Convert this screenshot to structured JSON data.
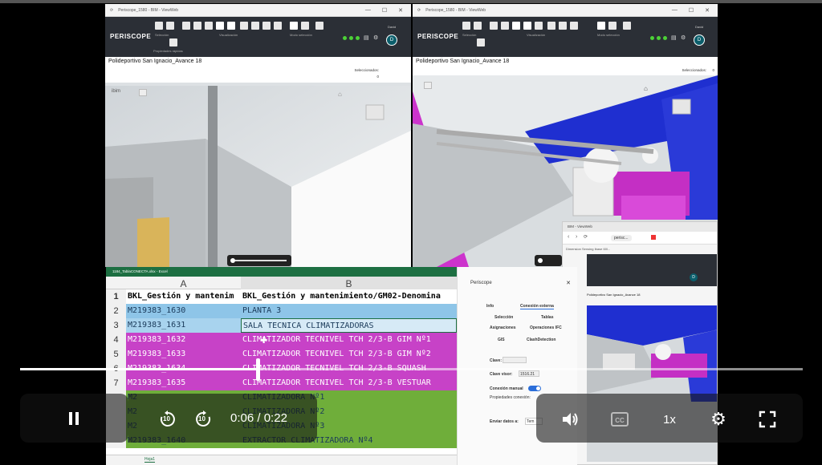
{
  "left_window": {
    "tab_title": "Periscope_1580 - BIM - ViewWeb",
    "brand": "PERISCOPE",
    "ribbon_groups": [
      "Selección",
      "Visualización",
      "Modo selección",
      "Propiedades rápidas"
    ],
    "user": "David",
    "avatar_letter": "D",
    "doc_title": "Polideportivo San Ignacio_Avance 18",
    "selected_label": "Seleccionados:",
    "selected_count": "0",
    "viewer_tag": "ibim"
  },
  "right_window": {
    "tab_title": "Periscope_1580 - BIM - ViewWeb",
    "brand": "PERISCOPE",
    "ribbon_groups": [
      "Selección",
      "Visualización",
      "Modo selección"
    ],
    "user": "David",
    "avatar_letter": "D",
    "doc_title": "Polideportivo San Ignacio_Avance 18",
    "selected_label": "Seleccionados:",
    "selected_count": "0"
  },
  "mini_window": {
    "tab_title": "BIM - ViewWeb",
    "address": "perisc...",
    "breadcrumb": "Dimension Sensing Ibase 60l...",
    "doc_title": "Polideportivo San Ignacio_Avance 18",
    "avatar_letter": "D"
  },
  "excel": {
    "title": "1184_TablaCONECTA.xlsx - Excel",
    "col_a": "A",
    "col_b": "B",
    "header_a": "BKL_Gestión y mantenim",
    "header_b": "BKL_Gestión y mantenimiento/GM02-Denomina",
    "rows": [
      {
        "n": "2",
        "a": "M219383_1630",
        "b": "PLANTA 3"
      },
      {
        "n": "3",
        "a": "M219383_1631",
        "b": "SALA TECNICA CLIMATIZADORAS"
      },
      {
        "n": "4",
        "a": "M219383_1632",
        "b": "CLIMATIZADOR TECNIVEL TCH 2/3-B GIM Nº1"
      },
      {
        "n": "5",
        "a": "M219383_1633",
        "b": "CLIMATIZADOR TECNIVEL TCH 2/3-B GIM Nº2"
      },
      {
        "n": "6",
        "a": "M219383_1634",
        "b": "CLIMATIZADOR TECNIVEL TCH 2/3-B SQUASH"
      },
      {
        "n": "7",
        "a": "M219383_1635",
        "b": "CLIMATIZADOR TECNIVEL TCH 2/3-B VESTUAR"
      },
      {
        "n": "",
        "a": "M2",
        "b": "CLIMATIZADORA Nº1"
      },
      {
        "n": "",
        "a": "M2",
        "b": "CLIMATIZADORA Nº2"
      },
      {
        "n": "",
        "a": "M2",
        "b": "CLIMATIZADORA Nº3"
      },
      {
        "n": "",
        "a": "M219383_1640",
        "b": "EXTRACTOR CLIMATIZADORA Nº4"
      }
    ],
    "sheet_tab": "Hoja1"
  },
  "periscope_panel": {
    "title": "Periscope",
    "tab_info": "Info",
    "tab_conexion": "Conexión externa",
    "btn_seleccion": "Selección",
    "btn_tablas": "Tablas",
    "btn_asignaciones": "Asignaciones",
    "btn_operaciones": "Operaciones IFC",
    "btn_gis": "GIS",
    "btn_clash": "ClashDetection",
    "clave_label": "Clave:",
    "clave_visor_label": "Clave visor:",
    "clave_visor_value": "1516.21",
    "conexion_manual": "Conexión manual",
    "propiedades_label": "Propiedades conexión:",
    "enviar_label": "Enviar datos a:",
    "enviar_value": "Tem"
  },
  "player": {
    "current_time": "0:06",
    "separator": "/",
    "duration": "0:22",
    "progress": 0.304,
    "speed": "1x",
    "rewind_seconds": "10",
    "forward_seconds": "10"
  },
  "colors": {
    "magenta": "#c030c0",
    "blue_row": "#8ec5e8",
    "green_row": "#6fae3a",
    "accent_blue": "#1f2fd0"
  }
}
